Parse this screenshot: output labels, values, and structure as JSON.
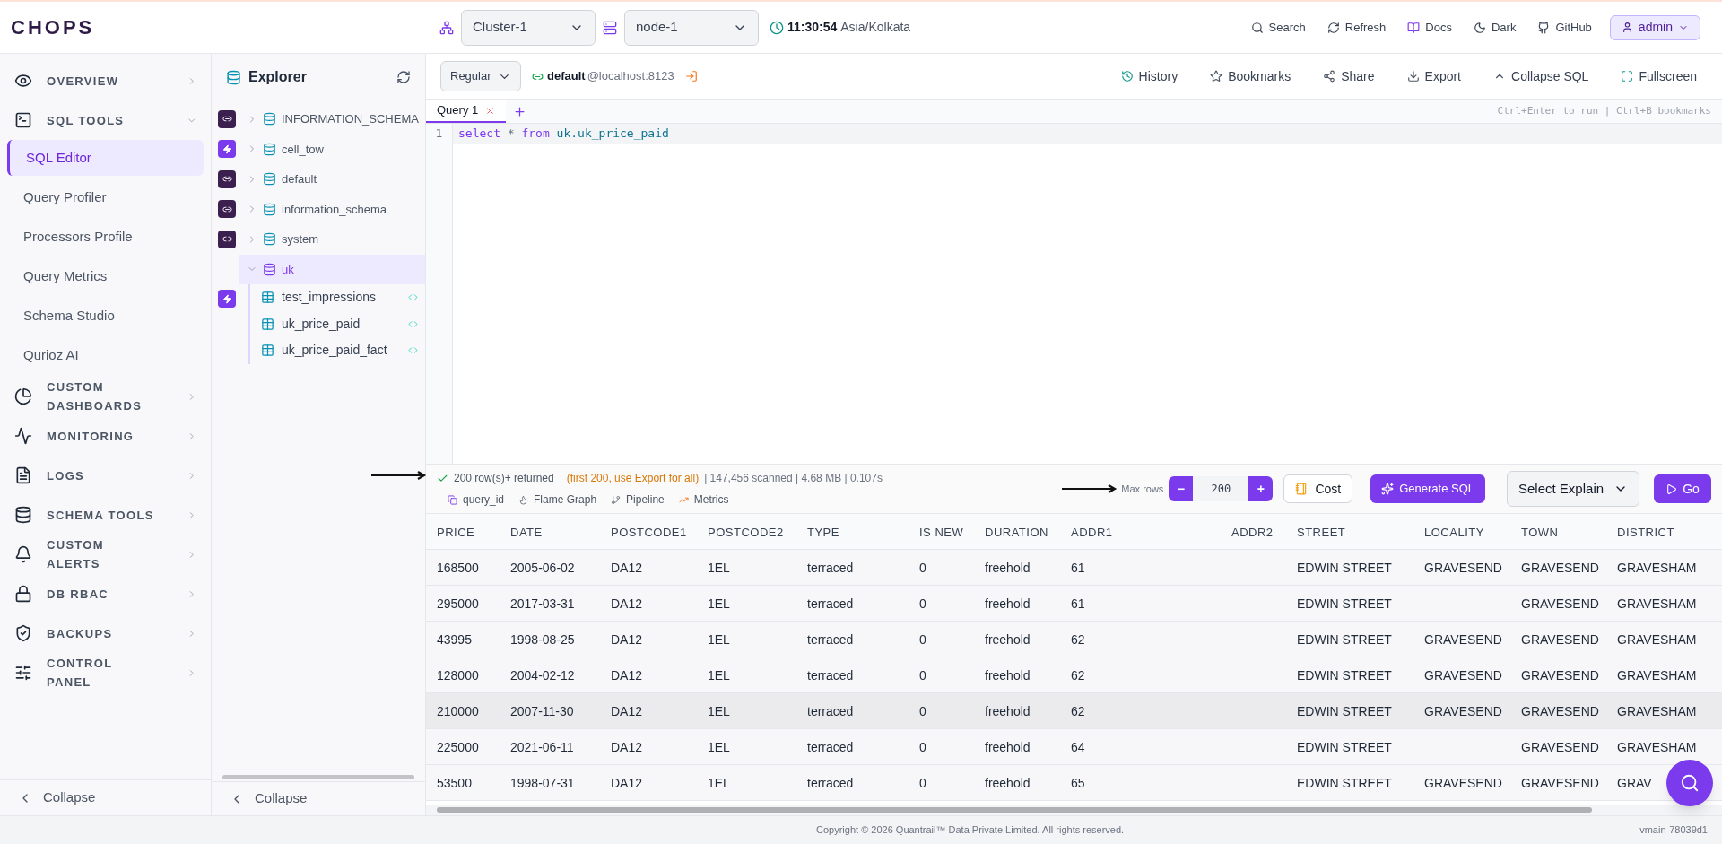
{
  "topbar": {
    "logo": "CHOPS",
    "cluster": "Cluster-1",
    "node": "node-1",
    "time": "11:30:54",
    "timezone": "Asia/Kolkata",
    "actions": [
      "Search",
      "Refresh",
      "Docs",
      "Dark",
      "GitHub"
    ],
    "user": "admin"
  },
  "sidebar": {
    "items": [
      {
        "kind": "section",
        "label": "OVERVIEW",
        "expanded": false
      },
      {
        "kind": "section",
        "label": "SQL TOOLS",
        "expanded": true
      },
      {
        "kind": "link",
        "label": "SQL Editor",
        "selected": true
      },
      {
        "kind": "link",
        "label": "Query Profiler",
        "selected": false
      },
      {
        "kind": "link",
        "label": "Processors Profile",
        "selected": false
      },
      {
        "kind": "link",
        "label": "Query Metrics",
        "selected": false
      },
      {
        "kind": "link",
        "label": "Schema Studio",
        "selected": false
      },
      {
        "kind": "link",
        "label": "Qurioz AI",
        "selected": false
      },
      {
        "kind": "section",
        "label": "CUSTOM DASHBOARDS",
        "expanded": false
      },
      {
        "kind": "section",
        "label": "MONITORING",
        "expanded": false
      },
      {
        "kind": "section",
        "label": "LOGS",
        "expanded": false
      },
      {
        "kind": "section",
        "label": "SCHEMA TOOLS",
        "expanded": false
      },
      {
        "kind": "section",
        "label": "CUSTOM ALERTS",
        "expanded": false
      },
      {
        "kind": "section",
        "label": "DB RBAC",
        "expanded": false
      },
      {
        "kind": "section",
        "label": "BACKUPS",
        "expanded": false
      },
      {
        "kind": "section",
        "label": "CONTROL PANEL",
        "expanded": false
      }
    ],
    "collapse": "Collapse"
  },
  "explorer": {
    "title": "Explorer",
    "tree": [
      {
        "label": "INFORMATION_SCHEMA",
        "badge": {
          "kind": "link"
        },
        "expanded": false,
        "selected": false
      },
      {
        "label": "cell_tow",
        "badge": {
          "kind": "bolt"
        },
        "expanded": false,
        "selected": false
      },
      {
        "label": "default",
        "badge": {
          "kind": "link"
        },
        "expanded": false,
        "selected": false
      },
      {
        "label": "information_schema",
        "badge": {
          "kind": "link"
        },
        "expanded": false,
        "selected": false
      },
      {
        "label": "system",
        "badge": {
          "kind": "link"
        },
        "expanded": false,
        "selected": false
      },
      {
        "label": "uk",
        "expanded": true,
        "selected": true,
        "side_badge": {
          "kind": "bolt"
        },
        "children": [
          {
            "label": "test_impressions"
          },
          {
            "label": "uk_price_paid"
          },
          {
            "label": "uk_price_paid_fact"
          }
        ]
      }
    ],
    "collapse": "Collapse"
  },
  "editor": {
    "mode": "Regular",
    "connection_db": "default",
    "connection_host": "@localhost:8123",
    "toolbar": [
      "History",
      "Bookmarks",
      "Share",
      "Export",
      "Collapse SQL",
      "Fullscreen"
    ],
    "tabs": [
      {
        "label": "Query 1",
        "selected": true
      }
    ],
    "hint": "Ctrl+Enter to run | Ctrl+B bookmarks",
    "lines": [
      {
        "number": "1",
        "keyword1": "select",
        "op": "*",
        "keyword2": "from",
        "rest": "uk.uk_price_paid"
      }
    ]
  },
  "results": {
    "returned": "200 row(s)+ returned",
    "note": "(first 200, use Export for all)",
    "stats": "| 147,456 scanned | 4.68 MB | 0.107s",
    "links": [
      "query_id",
      "Flame Graph",
      "Pipeline",
      "Metrics"
    ],
    "max_rows_label": "Max rows",
    "max_rows": "200",
    "minus": "−",
    "plus": "+",
    "cost": "Cost",
    "generate": "Generate SQL",
    "explain": "Select Explain",
    "go": "Go"
  },
  "table": {
    "columns": [
      "PRICE",
      "DATE",
      "POSTCODE1",
      "POSTCODE2",
      "TYPE",
      "IS NEW",
      "DURATION",
      "ADDR1",
      "ADDR2",
      "STREET",
      "LOCALITY",
      "TOWN",
      "DISTRICT"
    ],
    "rows": [
      {
        "selected": false,
        "cells": [
          "168500",
          "2005-06-02",
          "DA12",
          "1EL",
          "terraced",
          "0",
          "freehold",
          "61",
          "",
          "EDWIN STREET",
          "GRAVESEND",
          "GRAVESEND",
          "GRAVESHAM"
        ]
      },
      {
        "selected": false,
        "cells": [
          "295000",
          "2017-03-31",
          "DA12",
          "1EL",
          "terraced",
          "0",
          "freehold",
          "61",
          "",
          "EDWIN STREET",
          "",
          "GRAVESEND",
          "GRAVESHAM"
        ]
      },
      {
        "selected": false,
        "cells": [
          "43995",
          "1998-08-25",
          "DA12",
          "1EL",
          "terraced",
          "0",
          "freehold",
          "62",
          "",
          "EDWIN STREET",
          "GRAVESEND",
          "GRAVESEND",
          "GRAVESHAM"
        ]
      },
      {
        "selected": false,
        "cells": [
          "128000",
          "2004-02-12",
          "DA12",
          "1EL",
          "terraced",
          "0",
          "freehold",
          "62",
          "",
          "EDWIN STREET",
          "GRAVESEND",
          "GRAVESEND",
          "GRAVESHAM"
        ]
      },
      {
        "selected": true,
        "cells": [
          "210000",
          "2007-11-30",
          "DA12",
          "1EL",
          "terraced",
          "0",
          "freehold",
          "62",
          "",
          "EDWIN STREET",
          "GRAVESEND",
          "GRAVESEND",
          "GRAVESHAM"
        ]
      },
      {
        "selected": false,
        "cells": [
          "225000",
          "2021-06-11",
          "DA12",
          "1EL",
          "terraced",
          "0",
          "freehold",
          "64",
          "",
          "EDWIN STREET",
          "",
          "GRAVESEND",
          "GRAVESHAM"
        ]
      },
      {
        "selected": false,
        "cells": [
          "53500",
          "1998-07-31",
          "DA12",
          "1EL",
          "terraced",
          "0",
          "freehold",
          "65",
          "",
          "EDWIN STREET",
          "GRAVESEND",
          "GRAVESEND",
          "GRAV"
        ]
      }
    ]
  },
  "footer": {
    "copyright": "Copyright © 2026 Quantrail™ Data Private Limited. All rights reserved.",
    "version": "vmain-78039d1"
  }
}
